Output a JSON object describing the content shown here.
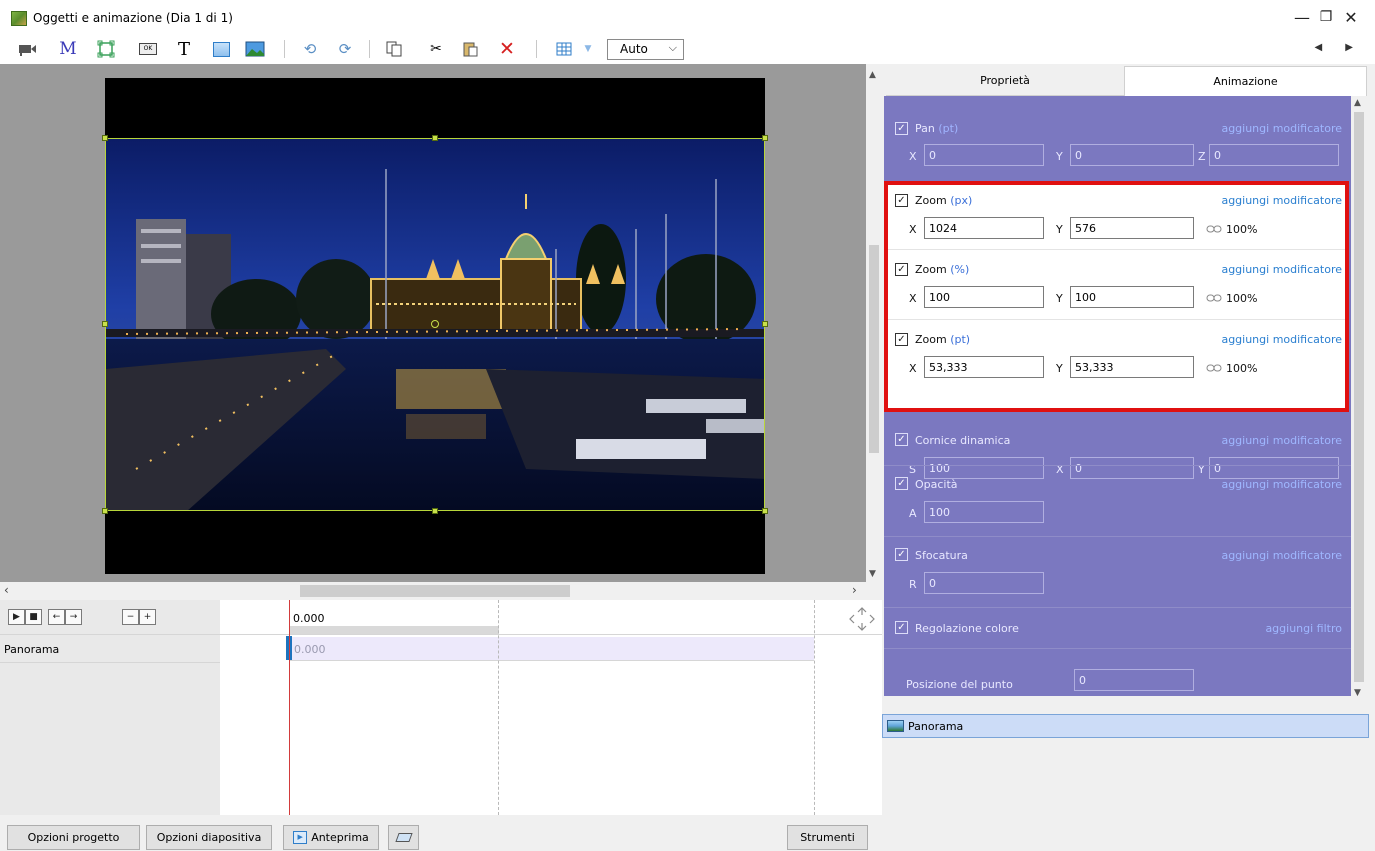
{
  "window": {
    "title": "Oggetti e animazione (Dia 1 di 1)",
    "minimize": "—",
    "maximize": "❐",
    "close": "✕"
  },
  "toolbar": {
    "M_label": "M",
    "T_label": "T",
    "ok_label": "OK",
    "auto_select": "Auto",
    "nav": "◀ ▶"
  },
  "tabs": {
    "properties": "Proprietà",
    "animation": "Animazione"
  },
  "pan": {
    "label": "Pan",
    "unit": "(pt)",
    "modifier": "aggiungi modificatore",
    "x_axis": "X",
    "x": "0",
    "y_axis": "Y",
    "y": "0",
    "z_axis": "Z",
    "z": "0"
  },
  "zoom_px": {
    "label": "Zoom",
    "unit": "(px)",
    "modifier": "aggiungi modificatore",
    "x_axis": "X",
    "x": "1024",
    "y_axis": "Y",
    "y": "576",
    "ratio": "100%"
  },
  "zoom_pct": {
    "label": "Zoom",
    "unit": "(%)",
    "modifier": "aggiungi modificatore",
    "x_axis": "X",
    "x": "100",
    "y_axis": "Y",
    "y": "100",
    "ratio": "100%"
  },
  "zoom_pt": {
    "label": "Zoom",
    "unit": "(pt)",
    "modifier": "aggiungi modificatore",
    "x_axis": "X",
    "x": "53,333",
    "y_axis": "Y",
    "y": "53,333",
    "ratio": "100%"
  },
  "dynamic_frame": {
    "label": "Cornice dinamica",
    "modifier": "aggiungi modificatore",
    "s_axis": "S",
    "s": "100",
    "x_axis": "X",
    "x": "0",
    "y_axis": "Y",
    "y": "0"
  },
  "opacity": {
    "label": "Opacità",
    "modifier": "aggiungi modificatore",
    "a_axis": "A",
    "a": "100"
  },
  "blur": {
    "label": "Sfocatura",
    "modifier": "aggiungi modificatore",
    "r_axis": "R",
    "r": "0"
  },
  "color_adjust": {
    "label": "Regolazione colore",
    "filter": "aggiungi filtro"
  },
  "point_position": {
    "label": "Posizione del punto",
    "value": "0"
  },
  "object_list": {
    "item": "Panorama"
  },
  "timeline": {
    "time": "0.000",
    "clip_time": "0.000",
    "track": "Panorama",
    "play": "▶",
    "stop": "■",
    "prev": "←",
    "next": "→",
    "minus": "−",
    "plus": "+"
  },
  "bottom": {
    "project_options": "Opzioni progetto",
    "slide_options": "Opzioni diapositiva",
    "preview": "Anteprima",
    "tools": "Strumenti"
  },
  "colors": {
    "panel_bg": "#7b78c0",
    "highlight": "#e01010",
    "link": "#2a7fd0"
  }
}
